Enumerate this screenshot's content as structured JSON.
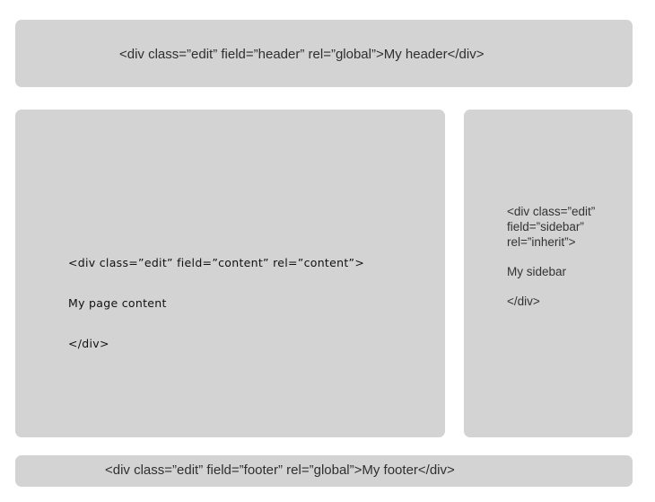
{
  "header": {
    "code": "<div class=”edit” field=”header” rel=”global”>My header</div>"
  },
  "content": {
    "lines": [
      "<div class=”edit” field=”content” rel=”content”>",
      "My page content",
      "</div>"
    ]
  },
  "sidebar": {
    "lines": [
      "<div class=”edit”",
      "field=”sidebar”",
      "rel=”inherit”>",
      "My sidebar",
      "</div>"
    ]
  },
  "footer": {
    "code": "<div class=”edit” field=”footer” rel=”global”>My footer</div>"
  },
  "colors": {
    "box_fill": "#d3d3d3",
    "text": "#2f2f2f",
    "background": "#ffffff"
  }
}
